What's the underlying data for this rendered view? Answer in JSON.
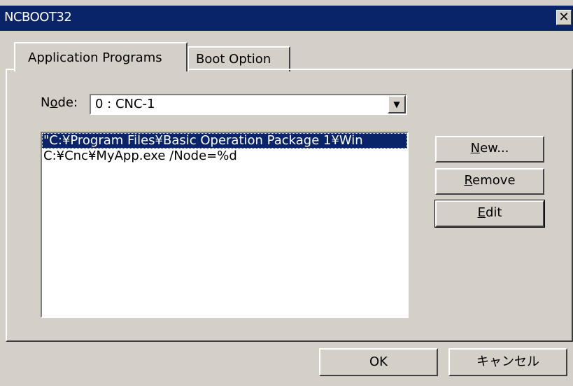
{
  "window": {
    "title": "NCBOOT32",
    "close_glyph": "✕"
  },
  "tabs": [
    {
      "label": "Application Programs",
      "active": true
    },
    {
      "label": "Boot Option",
      "active": false
    }
  ],
  "node": {
    "label_prefix": "N",
    "label_accel": "o",
    "label_suffix": "de:",
    "value": "0 : CNC-1"
  },
  "programs": [
    "\"C:¥Program Files¥Basic Operation Package 1¥Win",
    "C:¥Cnc¥MyApp.exe /Node=%d"
  ],
  "side_buttons": {
    "new": {
      "accel": "N",
      "rest": "ew..."
    },
    "remove": {
      "accel": "R",
      "rest": "emove"
    },
    "edit": {
      "accel": "E",
      "rest": "dit"
    }
  },
  "footer": {
    "ok_label": "OK",
    "cancel_label": "キャンセル"
  },
  "colors": {
    "titlebar": "#0a246a",
    "face": "#d4d0c8",
    "selection": "#0a246a"
  }
}
